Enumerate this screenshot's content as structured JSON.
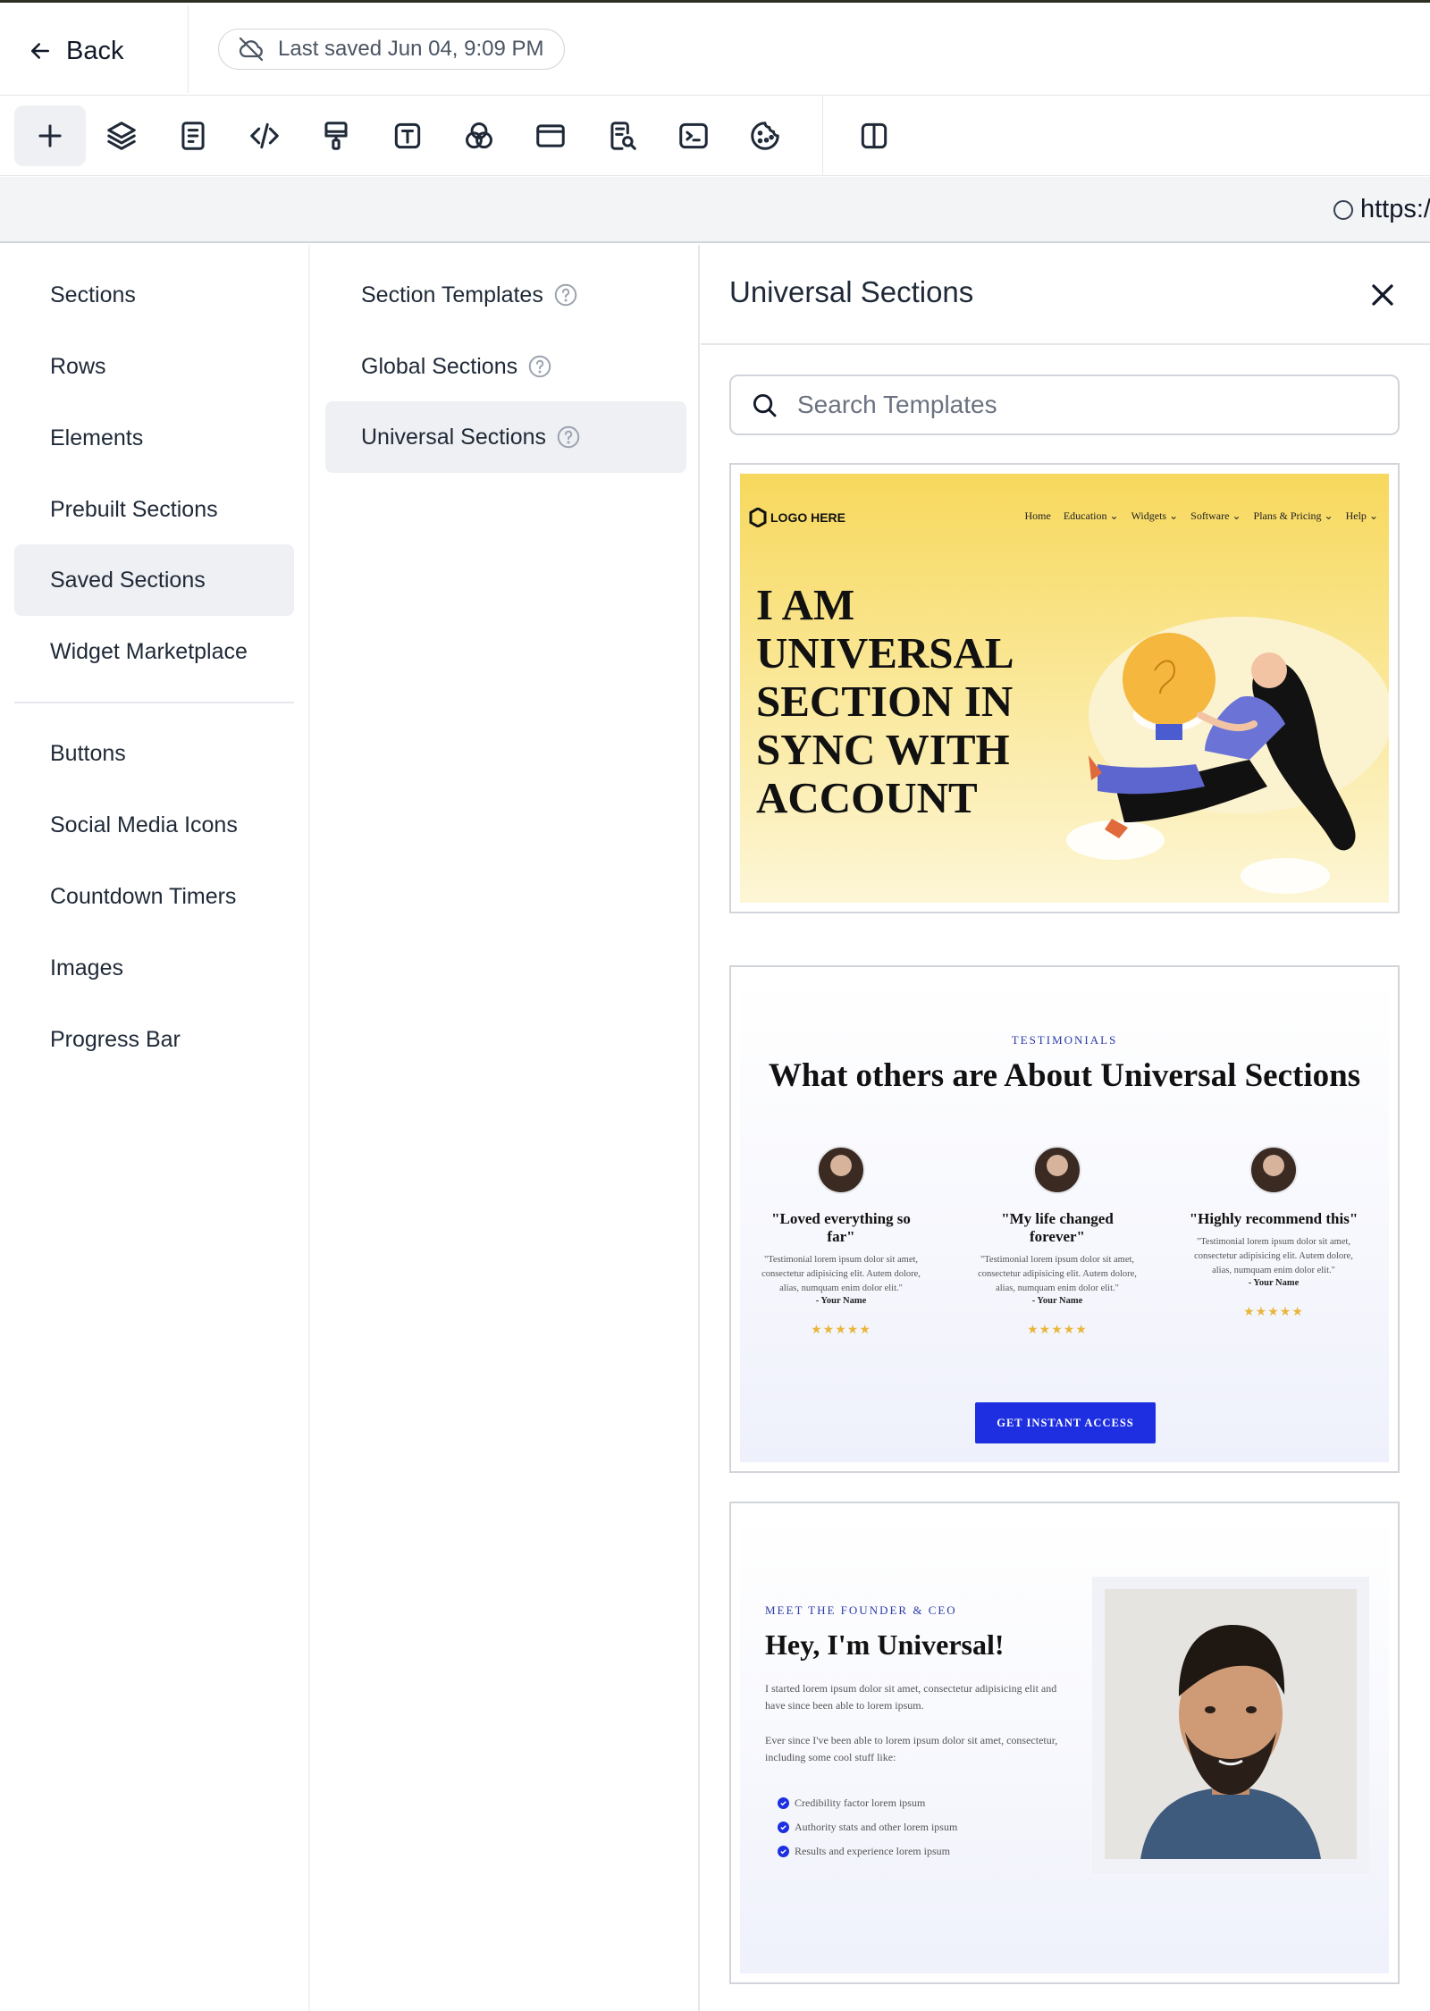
{
  "header": {
    "back_label": "Back",
    "saved_status": "Last saved Jun 04, 9:09 PM"
  },
  "toolbar": {
    "tools": [
      "add-icon",
      "layers-icon",
      "page-icon",
      "code-icon",
      "paint-roller-icon",
      "text-icon",
      "blend-icon",
      "browser-window-icon",
      "page-search-icon",
      "terminal-icon",
      "cookie-icon",
      "split-view-icon"
    ]
  },
  "urlbar": {
    "url_text": "https:/"
  },
  "leftnav": {
    "items": [
      {
        "label": "Sections"
      },
      {
        "label": "Rows"
      },
      {
        "label": "Elements"
      },
      {
        "label": "Prebuilt Sections"
      },
      {
        "label": "Saved Sections",
        "active": true
      },
      {
        "label": "Widget Marketplace"
      },
      {
        "label": "Buttons"
      },
      {
        "label": "Social Media Icons"
      },
      {
        "label": "Countdown Timers"
      },
      {
        "label": "Images"
      },
      {
        "label": "Progress Bar"
      }
    ]
  },
  "midcol": {
    "items": [
      {
        "label": "Section Templates"
      },
      {
        "label": "Global Sections"
      },
      {
        "label": "Universal Sections",
        "active": true
      }
    ]
  },
  "panel": {
    "title": "Universal Sections",
    "search_placeholder": "Search Templates"
  },
  "templates": {
    "hero": {
      "logo": "LOGO HERE",
      "nav": [
        "Home",
        "Education",
        "Widgets",
        "Software",
        "Plans & Pricing",
        "Help"
      ],
      "headline": "I AM UNIVERSAL SECTION IN SYNC WITH ACCOUNT"
    },
    "testimonials": {
      "eyebrow": "TESTIMONIALS",
      "title": "What others are About Universal Sections",
      "columns": [
        {
          "quote": "\"Loved everything so far\"",
          "body": "\"Testimonial lorem ipsum dolor sit amet, consectetur adipisicing elit. Autem dolore, alias, numquam enim dolor elit.\"",
          "name": "- Your Name",
          "stars": "★★★★★"
        },
        {
          "quote": "\"My life changed forever\"",
          "body": "\"Testimonial lorem ipsum dolor sit amet, consectetur adipisicing elit. Autem dolore, alias, numquam enim dolor elit.\"",
          "name": "- Your Name",
          "stars": "★★★★★"
        },
        {
          "quote": "\"Highly recommend this\"",
          "body": "\"Testimonial lorem ipsum dolor sit amet, consectetur adipisicing elit. Autem dolore, alias, numquam enim dolor elit.\"",
          "name": "- Your Name",
          "stars": "★★★★★"
        }
      ],
      "cta": "GET INSTANT ACCESS"
    },
    "founder": {
      "eyebrow": "MEET THE FOUNDER & CEO",
      "title": "Hey, I'm Universal!",
      "p1": "I started lorem ipsum dolor sit amet, consectetur adipisicing elit and have since been able to lorem ipsum.",
      "p2": "Ever since I've been able to lorem ipsum dolor sit amet, consectetur, including some cool stuff like:",
      "list": [
        "Credibility factor lorem ipsum",
        "Authority stats and other lorem ipsum",
        "Results and experience lorem ipsum"
      ]
    }
  },
  "colors": {
    "accent_blue": "#1d2fe0",
    "active_bg": "#eef0f3",
    "hero_yellow": "#f7d85c"
  }
}
